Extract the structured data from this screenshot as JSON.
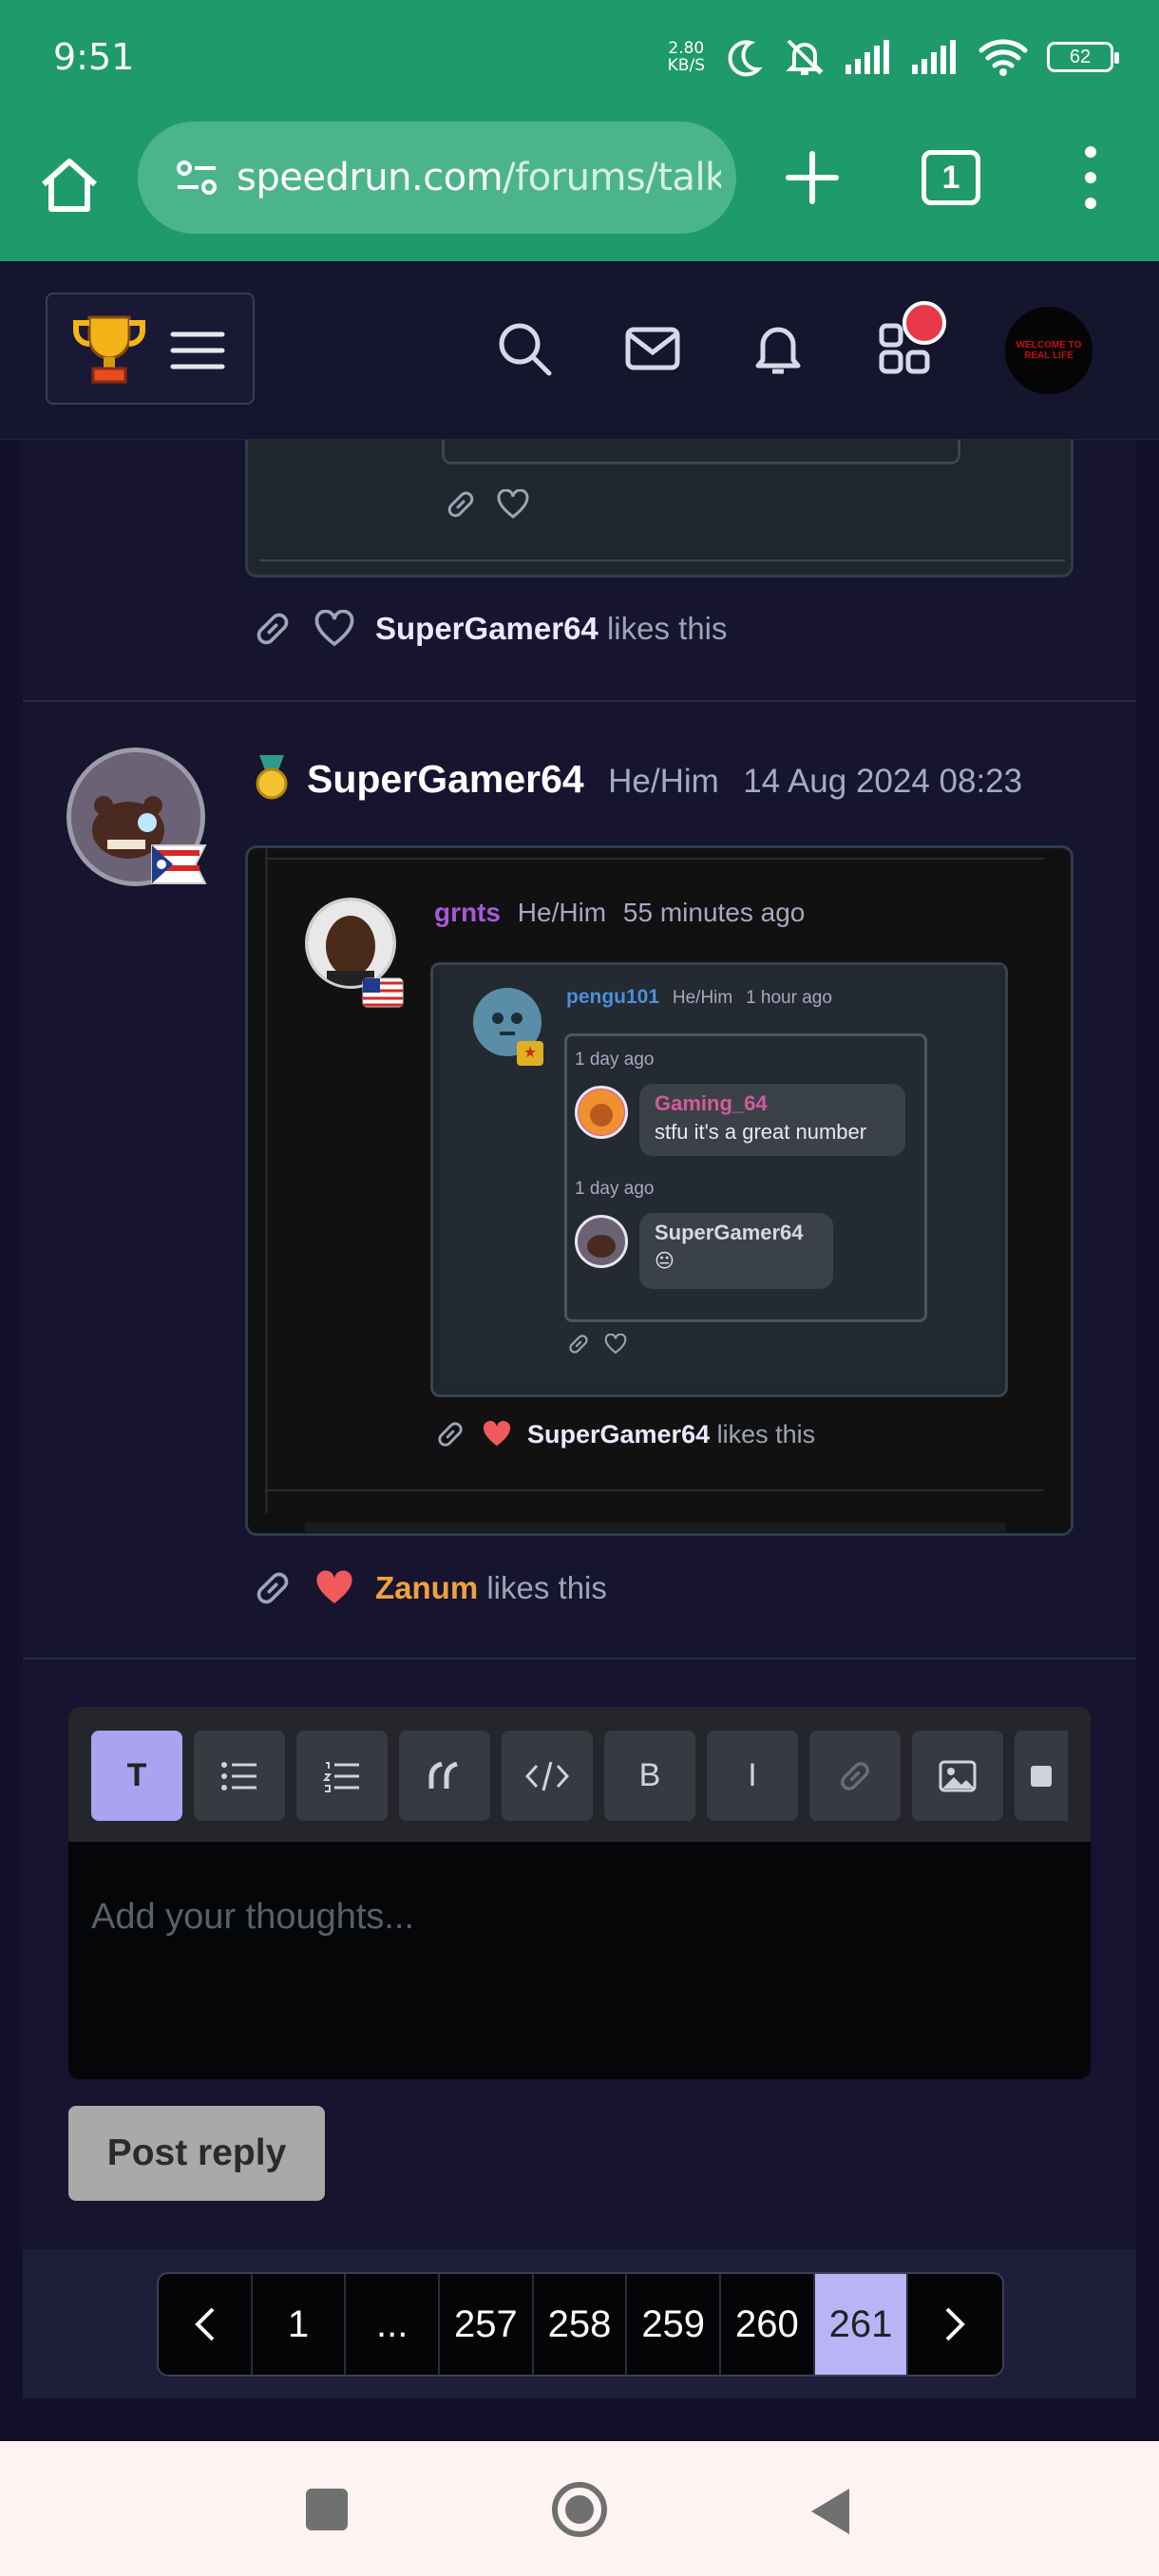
{
  "status_bar": {
    "time": "9:51",
    "net_speed_value": "2.80",
    "net_speed_unit": "KB/S",
    "battery": "62"
  },
  "browser": {
    "url_host": "speedrun.com",
    "url_path": "/forums/talk",
    "tab_count": "1"
  },
  "site_header": {
    "avatar_text": "WELCOME TO REAL LIFE"
  },
  "prev_post": {
    "like_user": "SuperGamer64",
    "like_suffix": "likes this"
  },
  "post": {
    "author": "SuperGamer64",
    "pronouns": "He/Him",
    "date": "14 Aug 2024 08:23",
    "quote": {
      "author": "grnts",
      "pronouns": "He/Him",
      "time": "55 minutes ago",
      "nested": {
        "author": "pengu101",
        "pronouns": "He/Him",
        "time": "1 hour ago",
        "messages": [
          {
            "time": "1 day ago",
            "author": "Gaming_64",
            "text": "stfu it's a great number"
          },
          {
            "time": "1 day ago",
            "author": "SuperGamer64",
            "text": "😐"
          }
        ]
      },
      "like_user": "SuperGamer64",
      "like_suffix": "likes this"
    },
    "like_user": "Zanum",
    "like_suffix": "likes this"
  },
  "editor": {
    "toolbar": {
      "text_btn": "T",
      "bold_btn": "B",
      "italic_btn": "I"
    },
    "placeholder": "Add your thoughts...",
    "submit_label": "Post reply"
  },
  "pagination": {
    "pages": [
      "1",
      "...",
      "257",
      "258",
      "259",
      "260",
      "261"
    ],
    "current": "261"
  },
  "colors": {
    "browser_green": "#1f9a6b",
    "accent_purple": "#b9b4f6",
    "like_red": "#f05a5a",
    "zanum_orange": "#f0a040",
    "grnts_purple": "#a65ad8",
    "pengu_blue": "#4a90d9",
    "gaming_pink": "#d45a9c"
  }
}
